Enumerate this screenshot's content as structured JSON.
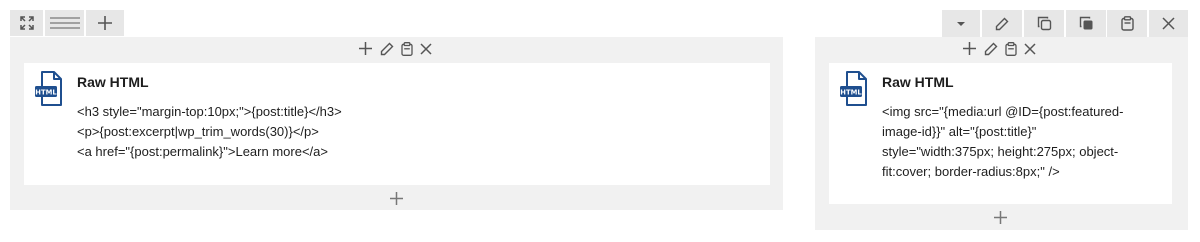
{
  "left_toolbar": {
    "icons": [
      "expand-icon",
      "list-layout-icon",
      "add-icon"
    ]
  },
  "right_toolbar": {
    "icons": [
      "chevron-down-icon",
      "edit-icon",
      "duplicate-icon",
      "copy-icon",
      "paste-icon",
      "close-icon"
    ]
  },
  "left_block": {
    "controls": [
      "add-icon",
      "edit-icon",
      "paste-icon",
      "close-icon"
    ],
    "element_title": "Raw HTML",
    "icon_label": "HTML",
    "code_lines": [
      "<h3 style=\"margin-top:10px;\">{post:title}</h3>",
      "<p>{post:excerpt|wp_trim_words(30)}</p>",
      "<a href=\"{post:permalink}\">Learn more</a>"
    ]
  },
  "right_block": {
    "controls": [
      "add-icon",
      "edit-icon",
      "paste-icon",
      "close-icon"
    ],
    "element_title": "Raw HTML",
    "icon_label": "HTML",
    "code_lines": [
      "<img src=\"{media:url @ID={post:featured-",
      "image-id}}\" alt=\"{post:title}\"",
      "style=\"width:375px; height:275px; object-",
      "fit:cover; border-radius:8px;\" />"
    ]
  },
  "colors": {
    "toolbar_bg": "#e7e7e7",
    "row_bg": "#f1f1f1",
    "card_bg": "#ffffff",
    "icon_blue": "#1f4f8f"
  }
}
